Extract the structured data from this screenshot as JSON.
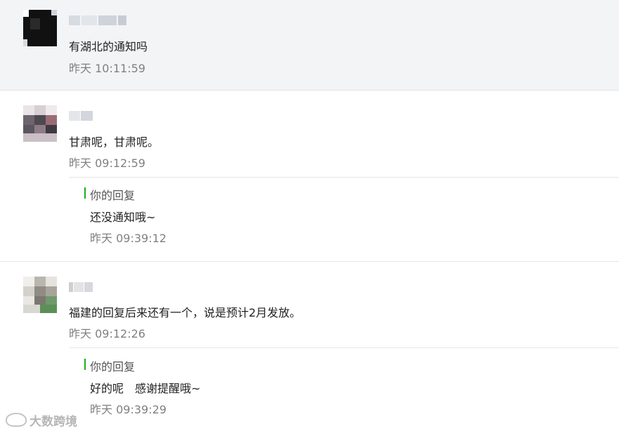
{
  "comments": [
    {
      "message": "有湖北的通知吗",
      "time": "昨天 10:11:59"
    },
    {
      "message": "甘肃呢，甘肃呢。",
      "time": "昨天 09:12:59",
      "reply": {
        "label": "你的回复",
        "message": "还没通知哦~",
        "time": "昨天 09:39:12"
      }
    },
    {
      "message": "福建的回复后来还有一个，说是预计2月发放。",
      "time": "昨天 09:12:26",
      "reply": {
        "label": "你的回复",
        "message": "好的呢　感谢提醒哦~",
        "time": "昨天 09:39:29"
      }
    }
  ],
  "watermark": {
    "text": "大数跨境"
  },
  "colors": {
    "highlight_bg": "#f3f4f6",
    "reply_accent": "#1aad19",
    "time_text": "#808080"
  }
}
